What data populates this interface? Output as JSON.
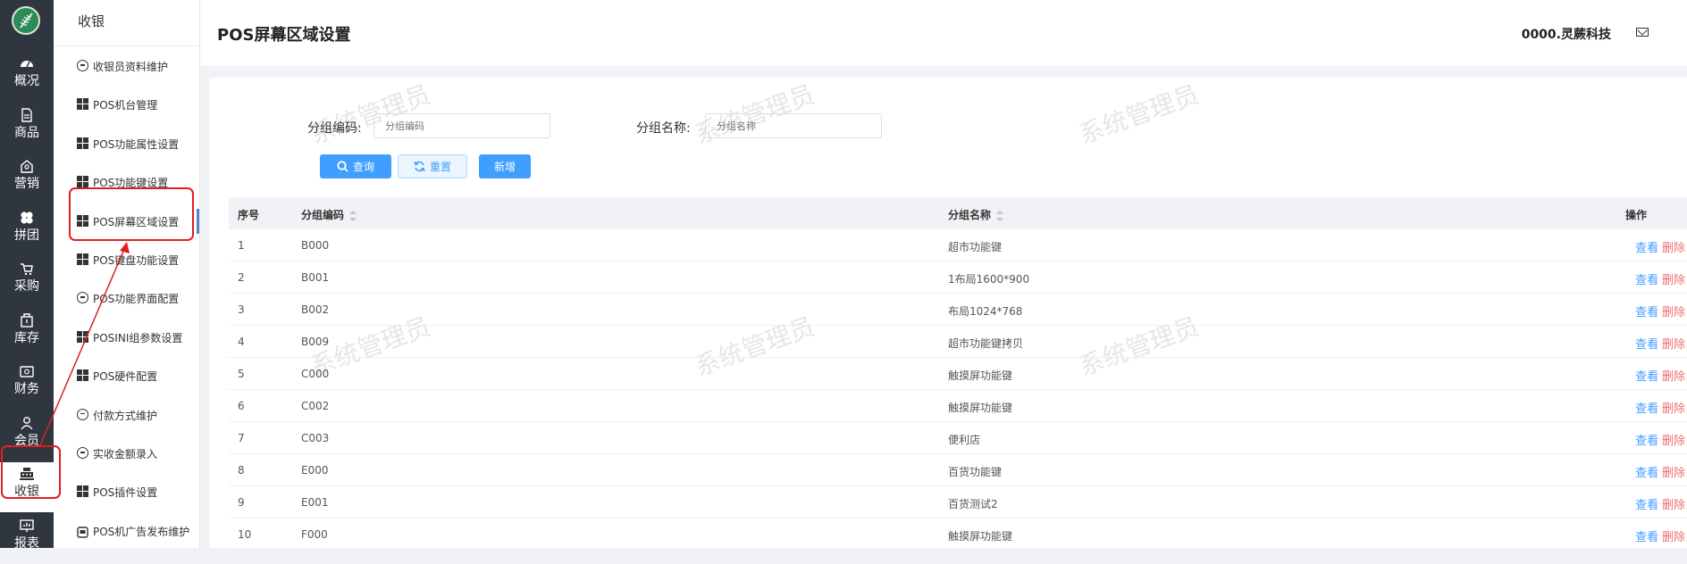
{
  "rail": {
    "items": [
      {
        "label": "概况",
        "icon": "dashboard-icon"
      },
      {
        "label": "商品",
        "icon": "document-icon"
      },
      {
        "label": "营销",
        "icon": "marketing-icon"
      },
      {
        "label": "拼团",
        "icon": "clover-icon"
      },
      {
        "label": "采购",
        "icon": "cart-icon"
      },
      {
        "label": "库存",
        "icon": "warehouse-icon"
      },
      {
        "label": "财务",
        "icon": "wallet-icon"
      },
      {
        "label": "会员",
        "icon": "user-icon"
      },
      {
        "label": "收银",
        "icon": "cash-register-icon"
      },
      {
        "label": "报表",
        "icon": "report-icon"
      }
    ],
    "active_index": 8
  },
  "subnav": {
    "title": "收银",
    "items": [
      {
        "label": "收银员资料维护",
        "icon": "chat-icon"
      },
      {
        "label": "POS机台管理",
        "icon": "grid-icon"
      },
      {
        "label": "POS功能属性设置",
        "icon": "grid-icon"
      },
      {
        "label": "POS功能键设置",
        "icon": "grid-icon"
      },
      {
        "label": "POS屏幕区域设置",
        "icon": "grid-icon"
      },
      {
        "label": "POS键盘功能设置",
        "icon": "grid-icon"
      },
      {
        "label": "POS功能界面配置",
        "icon": "chat-icon"
      },
      {
        "label": "POSINI组参数设置",
        "icon": "grid-icon"
      },
      {
        "label": "POS硬件配置",
        "icon": "grid-icon"
      },
      {
        "label": "付款方式维护",
        "icon": "chat-icon"
      },
      {
        "label": "实收金额录入",
        "icon": "chat-icon"
      },
      {
        "label": "POS插件设置",
        "icon": "grid-icon"
      },
      {
        "label": "POS机广告发布维护",
        "icon": "ad-icon"
      }
    ],
    "active_index": 4
  },
  "header": {
    "title": "POS屏幕区域设置",
    "org": "0000.灵蕨科技"
  },
  "watermark": "系统管理员",
  "filters": {
    "code_label": "分组编码:",
    "code_placeholder": "分组编码",
    "name_label": "分组名称:",
    "name_placeholder": "分组名称"
  },
  "buttons": {
    "query": "查询",
    "reset": "重置",
    "add": "新增"
  },
  "table": {
    "columns": [
      "序号",
      "分组编码",
      "分组名称",
      "操作"
    ],
    "rows": [
      {
        "no": "1",
        "code": "B000",
        "name": "超市功能键"
      },
      {
        "no": "2",
        "code": "B001",
        "name": "1布局1600*900"
      },
      {
        "no": "3",
        "code": "B002",
        "name": "布局1024*768"
      },
      {
        "no": "4",
        "code": "B009",
        "name": "超市功能键拷贝"
      },
      {
        "no": "5",
        "code": "C000",
        "name": "触摸屏功能键"
      },
      {
        "no": "6",
        "code": "C002",
        "name": "触摸屏功能键"
      },
      {
        "no": "7",
        "code": "C003",
        "name": "便利店"
      },
      {
        "no": "8",
        "code": "E000",
        "name": "百货功能键"
      },
      {
        "no": "9",
        "code": "E001",
        "name": "百货测试2"
      },
      {
        "no": "10",
        "code": "F000",
        "name": "触摸屏功能键"
      }
    ],
    "view_label": "查看",
    "delete_label": "删除"
  },
  "colors": {
    "rail_bg": "#303640",
    "primary": "#409eff",
    "danger": "#f56c6c",
    "annotation": "#e02020"
  }
}
